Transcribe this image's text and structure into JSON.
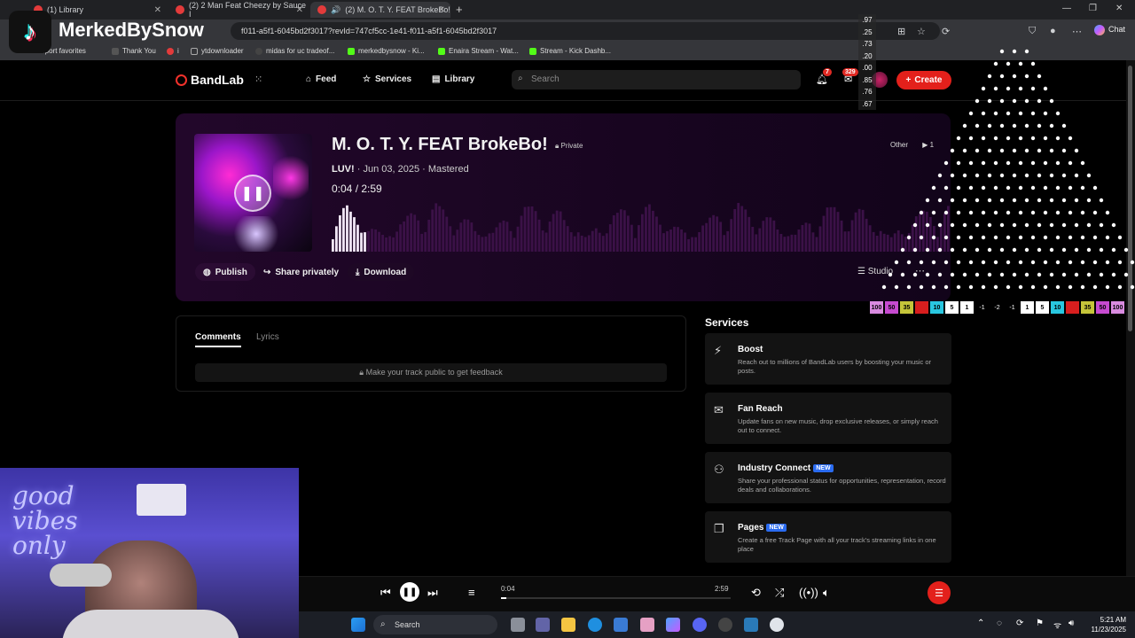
{
  "browser": {
    "tabs": [
      {
        "label": "(1) Library"
      },
      {
        "label": "(2) 2 Man Feat Cheezy by Sauce I"
      },
      {
        "label": "(2) M. O. T. Y. FEAT BrokeBo!"
      }
    ],
    "address": "f011-a5f1-6045bd2f3017?revId=747cf5cc-1e41-f011-a5f1-6045bd2f3017",
    "bookmarks": [
      "...port favorites",
      "Thank You",
      "i",
      "ytdownloader",
      "midas for uc tradeof...",
      "merkedbysnow - Ki...",
      "Enaira Stream - Wat...",
      "Stream - Kick Dashb..."
    ],
    "chat_label": "Chat"
  },
  "nav": {
    "logo": "BandLab",
    "feed": "Feed",
    "services": "Services",
    "library": "Library",
    "search_placeholder": "Search",
    "notif_count": "7",
    "msg_count": "329",
    "create": "Create"
  },
  "track": {
    "title": "M. O. T. Y. FEAT BrokeBo!",
    "privacy": "Private",
    "artist": "LUV!",
    "date_status": " · Jun 03, 2025 · Mastered",
    "current": "0:04",
    "separator": " / ",
    "duration": "2:59",
    "other_label": "Other",
    "other_count": "1",
    "publish": "Publish",
    "share": "Share privately",
    "download": "Download",
    "studio": "Studio",
    "progress": 0.022
  },
  "comments": {
    "tab_comments": "Comments",
    "tab_lyrics": "Lyrics",
    "feedback": "Make your track public to get feedback"
  },
  "services": {
    "title": "Services",
    "new_tag": "NEW",
    "items": [
      {
        "name": "Boost",
        "desc": "Reach out to millions of BandLab users by boosting your music or posts.",
        "icon": "bolt-icon"
      },
      {
        "name": "Fan Reach",
        "desc": "Update fans on new music, drop exclusive releases, or simply reach out to connect.",
        "icon": "mail-icon"
      },
      {
        "name": "Industry Connect",
        "desc": "Share your professional status for opportunities, representation, record deals and collaborations.",
        "icon": "people-icon"
      },
      {
        "name": "Pages",
        "desc": "Create a free Track Page with all your track's streaming links in one place",
        "icon": "pages-icon"
      }
    ]
  },
  "player": {
    "current": "0:04",
    "duration": "2:59"
  },
  "taskbar": {
    "search": "Search",
    "time": "5:21 AM",
    "date": "11/23/2025"
  },
  "overlay": {
    "watermark": "MerkedBySnow",
    "scale": [
      ".97",
      ".25",
      ".73",
      ".20",
      ".00",
      ".85",
      ".76",
      ".67"
    ],
    "meter": [
      "100",
      "50",
      "35",
      "",
      "10",
      "5",
      "1",
      "-1",
      "-2",
      "-1",
      "1",
      "5",
      "10",
      "",
      "35",
      "50",
      "100"
    ],
    "meter_colors": [
      "#d98be0",
      "#c64ad0",
      "#c5c53a",
      "#d81e1e",
      "#29c7e0",
      "#ffffff",
      "#ffffff",
      "",
      "",
      "",
      "#ffffff",
      "#ffffff",
      "#29c7e0",
      "#d81e1e",
      "#c5c53a",
      "#c64ad0",
      "#d98be0"
    ],
    "neon_text": "good vibes only"
  },
  "colors": {
    "accent": "#e3201b",
    "hero_bg": "#22072a"
  }
}
